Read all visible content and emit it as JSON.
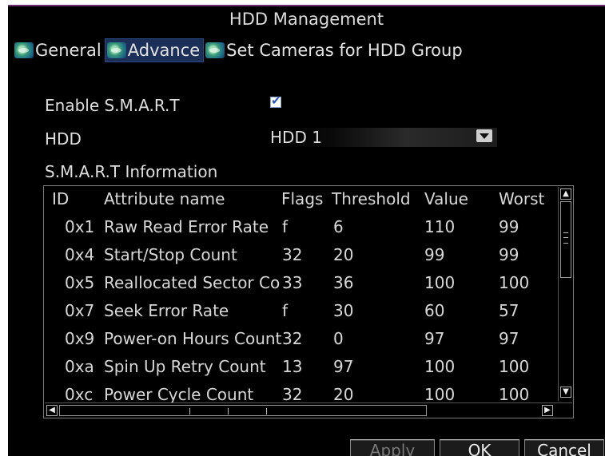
{
  "dialog": {
    "title": "HDD Management"
  },
  "tabs": [
    {
      "label": "General",
      "active": false
    },
    {
      "label": "Advance",
      "active": true
    },
    {
      "label": "Set Cameras for HDD Group",
      "active": false
    }
  ],
  "form": {
    "enable_smart_label": "Enable S.M.A.R.T",
    "enable_smart_checked": true,
    "check_glyph": "✔",
    "hdd_label": "HDD",
    "hdd_value": "HDD 1",
    "smart_info_label": "S.M.A.R.T Information"
  },
  "table": {
    "columns": [
      "ID",
      "Attribute name",
      "Flags",
      "Threshold",
      "Value",
      "Worst"
    ],
    "rows": [
      [
        "0x1",
        "Raw Read Error Rate",
        "f",
        "6",
        "110",
        "99"
      ],
      [
        "0x4",
        "Start/Stop Count",
        "32",
        "20",
        "99",
        "99"
      ],
      [
        "0x5",
        "Reallocated Sector Count",
        "33",
        "36",
        "100",
        "100"
      ],
      [
        "0x7",
        "Seek Error Rate",
        "f",
        "30",
        "60",
        "57"
      ],
      [
        "0x9",
        "Power-on Hours Count",
        "32",
        "0",
        "97",
        "97"
      ],
      [
        "0xa",
        "Spin Up Retry Count",
        "13",
        "97",
        "100",
        "100"
      ],
      [
        "0xc",
        "Power Cycle Count",
        "32",
        "20",
        "100",
        "100"
      ]
    ]
  },
  "scrollbar": {
    "up": "▲",
    "down": "▼",
    "left": "◀",
    "right": "▶"
  },
  "buttons": {
    "apply": "Apply",
    "ok": "OK",
    "cancel": "Cancel"
  },
  "colors": {
    "background": "#000000",
    "active_tab": "#1b2f58",
    "title_border": "#6b2e6b"
  }
}
